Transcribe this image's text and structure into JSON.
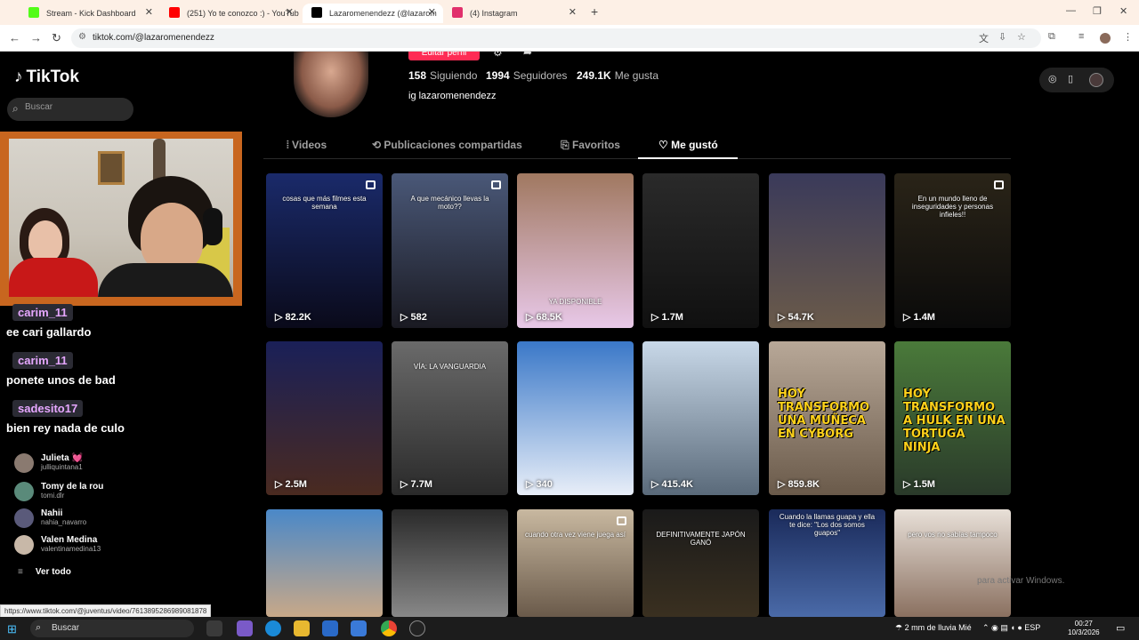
{
  "browser": {
    "tabs": [
      {
        "label": "Stream - Kick Dashboard",
        "color": "#53fc18"
      },
      {
        "label": "(251) Yo te conozco :) - YouTub",
        "color": "#ff0000"
      },
      {
        "label": "Lazaromenendezz (@lazarom",
        "color": "#000000"
      },
      {
        "label": "(4) Instagram",
        "color": "#e1306c"
      }
    ],
    "url": "tiktok.com/@lazaromenendezz"
  },
  "tiktok": {
    "logo": "TikTok",
    "search_placeholder": "Buscar",
    "edit_button": "Editar perfil",
    "stats": {
      "following_count": "158",
      "following_label": "Siguiendo",
      "followers_count": "1994",
      "followers_label": "Seguidores",
      "likes_count": "249.1K",
      "likes_label": "Me gusta"
    },
    "bio": "ig lazaromenendezz",
    "tabs": [
      "Videos",
      "Publicaciones compartidas",
      "Favoritos",
      "Me gustó"
    ],
    "videos": [
      {
        "views": "82.2K",
        "caption": "cosas que más filmes esta semana",
        "colors": [
          "#1a2a6a",
          "#0a0a1a"
        ]
      },
      {
        "views": "582",
        "caption": "A que mecánico llevas la moto??",
        "colors": [
          "#4a5878",
          "#1a1a22"
        ]
      },
      {
        "views": "68.5K",
        "caption": "YA DISPONIBLE",
        "colors": [
          "#a07860",
          "#e8c8e8"
        ]
      },
      {
        "views": "1.7M",
        "caption": "",
        "colors": [
          "#2a2a2a",
          "#101010"
        ]
      },
      {
        "views": "54.7K",
        "caption": "",
        "colors": [
          "#3a3a5a",
          "#6a5a4a"
        ]
      },
      {
        "views": "1.4M",
        "caption": "En un mundo lleno de inseguridades y personas infieles!!",
        "colors": [
          "#2a2418",
          "#0a0a0a"
        ]
      },
      {
        "views": "2.5M",
        "caption": "",
        "colors": [
          "#1a2058",
          "#4a2a20"
        ]
      },
      {
        "views": "7.7M",
        "caption": "VÍA: LA VANGUARDIA",
        "colors": [
          "#6a6a6a",
          "#2a2a2a"
        ]
      },
      {
        "views": "340",
        "caption": "",
        "colors": [
          "#3a78c8",
          "#e8eef8"
        ]
      },
      {
        "views": "415.4K",
        "caption": "",
        "colors": [
          "#c8d8e8",
          "#5a6a7a"
        ]
      },
      {
        "views": "859.8K",
        "caption": "HOY TRANSFORMO UNA MUÑECA EN CYBORG",
        "colors": [
          "#b8a898",
          "#6a5a4a"
        ]
      },
      {
        "views": "1.5M",
        "caption": "HOY TRANSFORMO A HULK EN UNA TORTUGA NINJA",
        "colors": [
          "#4a7a3a",
          "#2a3a2a"
        ]
      },
      {
        "views": "",
        "caption": "",
        "colors": [
          "#4a88c8",
          "#c8a888"
        ]
      },
      {
        "views": "",
        "caption": "",
        "colors": [
          "#2a2a2a",
          "#888888"
        ]
      },
      {
        "views": "",
        "caption": "cuando otra vez viene juega así",
        "colors": [
          "#c8b8a0",
          "#6a5a4a"
        ]
      },
      {
        "views": "",
        "caption": "DEFINITIVAMENTE JAPÓN GANÓ",
        "colors": [
          "#1a1a1a",
          "#3a3020"
        ]
      },
      {
        "views": "",
        "caption": "Cuando la llamas guapa y ella te dice: \"Los dos somos guapos\"",
        "colors": [
          "#1a2a5a",
          "#4a6aa8"
        ]
      },
      {
        "views": "",
        "caption": "pero vos no sabías tampoco",
        "colors": [
          "#e8e0d8",
          "#8a7060"
        ]
      }
    ]
  },
  "chat": [
    {
      "user": "carim_11",
      "msg": "ee cari gallardo"
    },
    {
      "user": "carim_11",
      "msg": "ponete unos de bad"
    },
    {
      "user": "sadesito17",
      "msg": "bien rey nada de culo"
    }
  ],
  "following": [
    {
      "name": "Julieta 💓",
      "handle": "julliquintana1"
    },
    {
      "name": "Tomy de la rou",
      "handle": "tomi.dlr"
    },
    {
      "name": "Nahii",
      "handle": "nahia_navarro"
    },
    {
      "name": "Valen Medina",
      "handle": "valentinamedina13"
    }
  ],
  "ver_todo": "Ver todo",
  "status_url": "https://www.tiktok.com/@juventus/video/7613895286989081878",
  "activate_windows": "para activar Windows.",
  "taskbar": {
    "search": "Buscar",
    "weather": "2 mm de lluvia Mié",
    "lang": "ESP",
    "time": "00:27",
    "date": "10/3/2026"
  }
}
